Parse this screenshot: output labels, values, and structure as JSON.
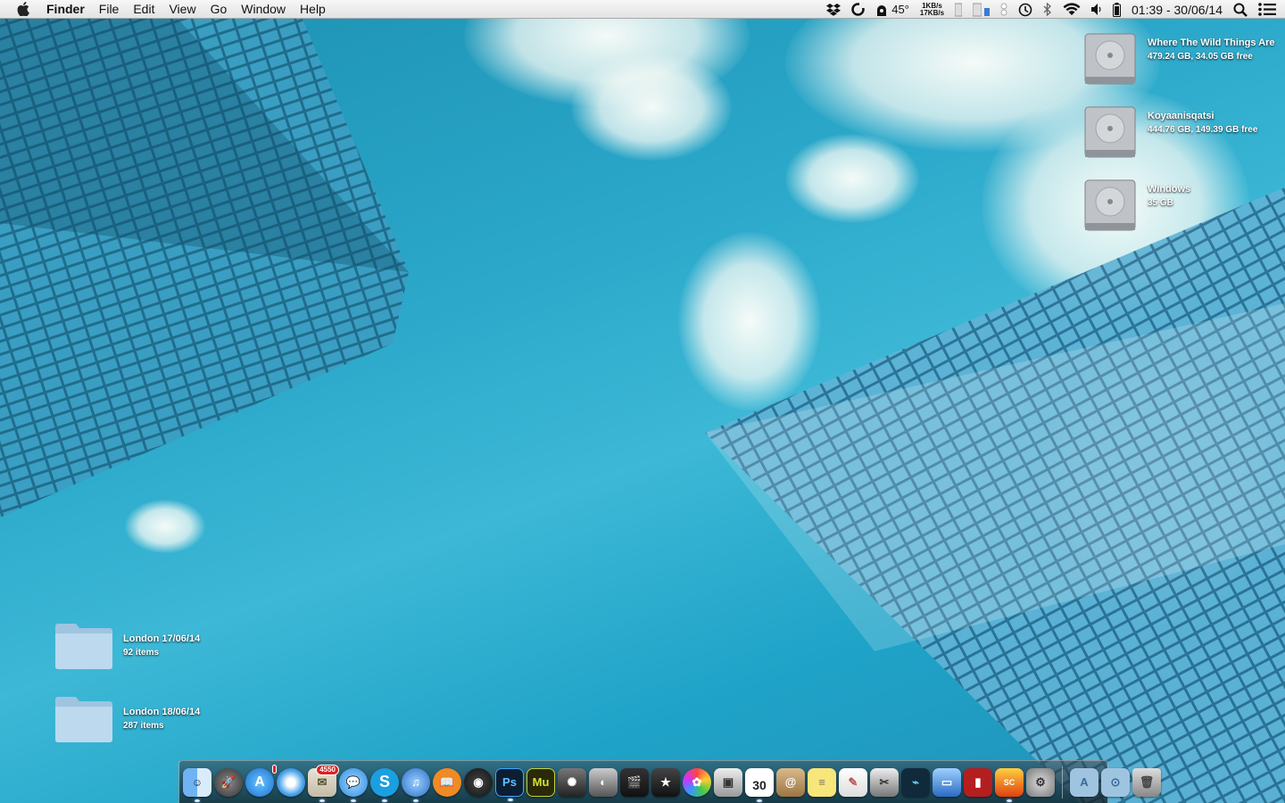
{
  "menubar": {
    "app_name": "Finder",
    "menus": [
      "File",
      "Edit",
      "View",
      "Go",
      "Window",
      "Help"
    ],
    "status": {
      "temperature": "45°",
      "net_up": "1KB/s",
      "net_down": "17KB/s",
      "clock": "01:39 - 30/06/14"
    }
  },
  "drives": [
    {
      "name": "Where The Wild Things Are",
      "detail": "479.24 GB, 34.05 GB free"
    },
    {
      "name": "Koyaanisqatsi",
      "detail": "444.76 GB, 149.39 GB free"
    },
    {
      "name": "Windows",
      "detail": "35 GB"
    }
  ],
  "folders": [
    {
      "name": "London 17/06/14",
      "detail": "92 items"
    },
    {
      "name": "London 18/06/14",
      "detail": "287 items"
    }
  ],
  "dock": {
    "calendar_day": "30",
    "mail_badge": "4550",
    "photoshop_label": "Ps",
    "muse_label": "Mu",
    "skype_label": "S"
  }
}
